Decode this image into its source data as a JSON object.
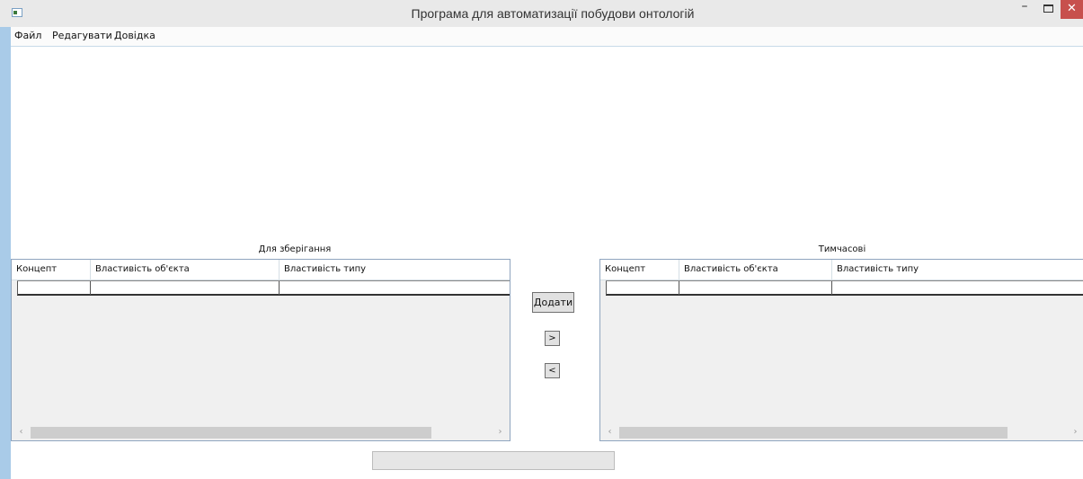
{
  "window": {
    "title": "Програма для автоматизації побудови онтологій",
    "minimize_glyph": "–",
    "close_glyph": "✕"
  },
  "menu": {
    "items": [
      "Файл",
      "Редагувати",
      "Довідка"
    ]
  },
  "storage_grid": {
    "title": "Для зберігання",
    "columns": [
      "Концепт",
      "Властивість об'єкта",
      "Властивість типу"
    ],
    "rows": [
      [
        "",
        "",
        ""
      ]
    ]
  },
  "temp_grid": {
    "title": "Тимчасові",
    "columns": [
      "Концепт",
      "Властивість об'єкта",
      "Властивість типу"
    ],
    "rows": [
      [
        "",
        "",
        ""
      ]
    ]
  },
  "buttons": {
    "add": "Додати",
    "move_right": ">",
    "move_left": "<"
  },
  "scrollbar": {
    "left_arrow": "‹",
    "right_arrow": "›"
  },
  "progress": {
    "value": 0
  },
  "colors": {
    "titlebar": "#e9e9e9",
    "close_button": "#c7504d",
    "window_frame": "#a9cbe8",
    "grid_background": "#f0f0f0",
    "progress_fill": "#06b025"
  }
}
